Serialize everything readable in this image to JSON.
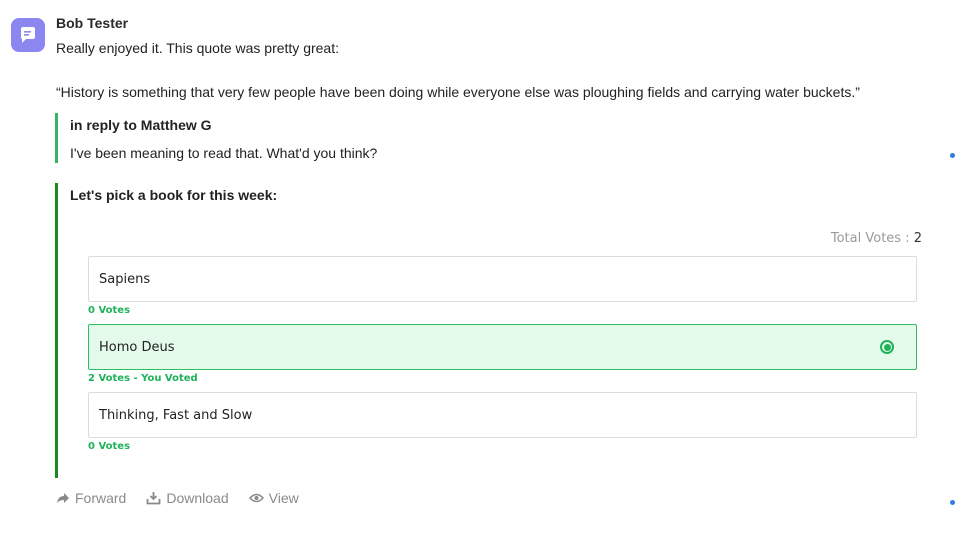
{
  "message": {
    "sender": "Bob Tester",
    "text": "Really enjoyed it. This quote was pretty great:",
    "quote": "“History is something that very few people have been doing while everyone else was ploughing fields and carrying water buckets.”"
  },
  "reply": {
    "heading": "in reply to Matthew G",
    "text": "I've been meaning to read that. What'd you think?"
  },
  "poll": {
    "question": "Let's pick a book for this week:",
    "total_label": "Total Votes",
    "total_sep": " : ",
    "total_value": "2",
    "options": [
      {
        "label": "Sapiens",
        "votes": "0 Votes",
        "selected": false
      },
      {
        "label": "Homo Deus",
        "votes": "2 Votes - You Voted",
        "selected": true
      },
      {
        "label": "Thinking, Fast and Slow",
        "votes": "0 Votes",
        "selected": false
      }
    ]
  },
  "actions": {
    "forward": "Forward",
    "download": "Download",
    "view": "View"
  },
  "colors": {
    "accent_green": "#1fb25a",
    "avatar": "#8b86f0",
    "unread_dot": "#2f7de1"
  }
}
